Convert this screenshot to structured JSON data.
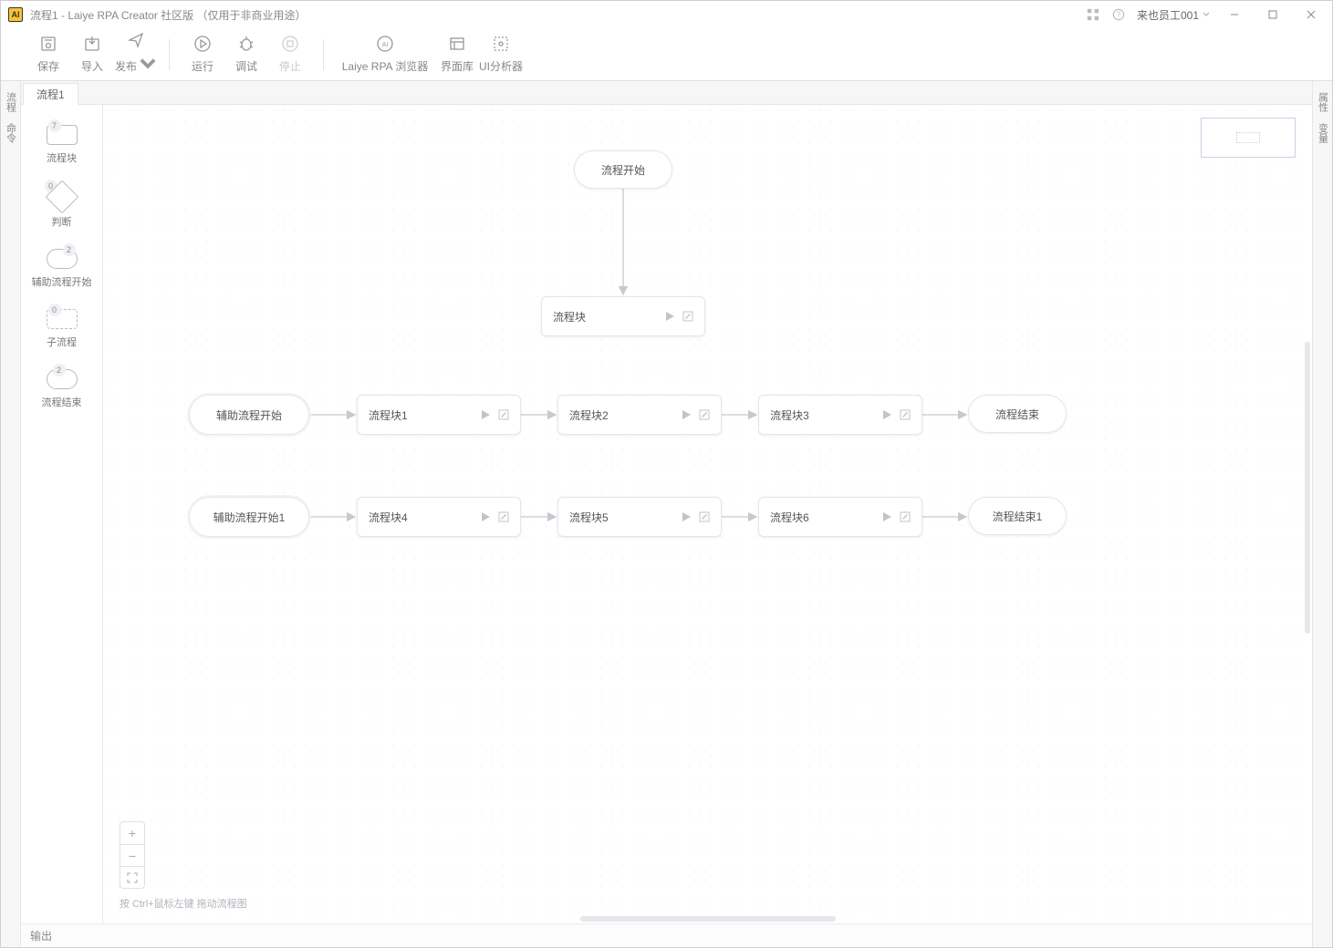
{
  "titlebar": {
    "title": "流程1 - Laiye RPA Creator 社区版 （仅用于非商业用途）",
    "user": "来也员工001"
  },
  "toolbar": {
    "save": "保存",
    "import": "导入",
    "publish": "发布",
    "run": "运行",
    "debug": "调试",
    "stop": "停止",
    "browser": "Laiye RPA 浏览器",
    "uilib": "界面库",
    "analyzer": "UI分析器"
  },
  "leftRail": {
    "process": "流程",
    "command": "命令"
  },
  "rightRail": {
    "properties": "属性",
    "variables": "变量"
  },
  "tabs": {
    "tab1": "流程1"
  },
  "palette": {
    "block": {
      "label": "流程块",
      "badge": "7"
    },
    "decision": {
      "label": "判断",
      "badge": "0"
    },
    "aux": {
      "label": "辅助流程开始",
      "badge": "2"
    },
    "sub": {
      "label": "子流程",
      "badge": "0"
    },
    "end": {
      "label": "流程结束",
      "badge": "2"
    }
  },
  "nodes": {
    "start": "流程开始",
    "main_block": "流程块",
    "aux1": "辅助流程开始",
    "b1": "流程块1",
    "b2": "流程块2",
    "b3": "流程块3",
    "end1": "流程结束",
    "aux2": "辅助流程开始1",
    "b4": "流程块4",
    "b5": "流程块5",
    "b6": "流程块6",
    "end2": "流程结束1"
  },
  "canvas": {
    "hint": "按 Ctrl+鼠标左键 拖动流程图"
  },
  "footer": {
    "output": "输出"
  }
}
